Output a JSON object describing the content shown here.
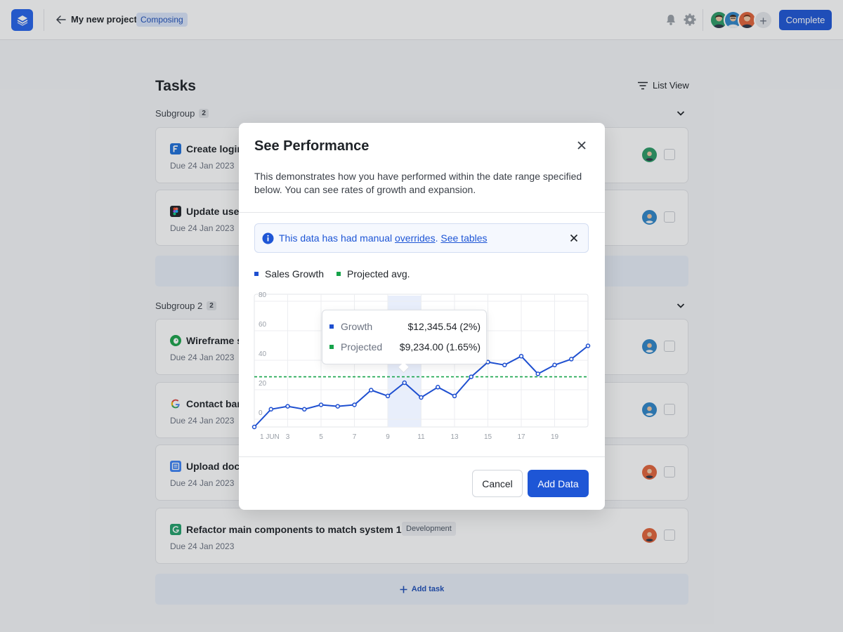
{
  "header": {
    "project_title": "My new project",
    "status_badge": "Composing",
    "complete_label": "Complete",
    "add_member": "+"
  },
  "main": {
    "title": "Tasks",
    "view_label": "List View",
    "subgroups": [
      {
        "label": "Subgroup",
        "count": "2"
      },
      {
        "label": "Subgroup 2",
        "count": "2"
      }
    ],
    "tasks": [
      {
        "title": "Create login",
        "due": "Due 24 Jan 2023",
        "icon": "f-app-icon",
        "icon_color": "#1e6fd9"
      },
      {
        "title": "Update user",
        "due": "Due 24 Jan 2023",
        "icon": "figma-icon",
        "icon_color": "#1f2328"
      },
      {
        "title": "Wireframe s",
        "due": "Due 24 Jan 2023",
        "icon": "evernote-icon",
        "icon_color": "#1aa34a"
      },
      {
        "title": "Contact ban",
        "due": "Due 24 Jan 2023",
        "icon": "google-icon",
        "icon_color": "#ffffff"
      },
      {
        "title": "Upload docu",
        "due": "Due 24 Jan 2023",
        "icon": "docs-icon",
        "icon_color": "#3b82f6"
      },
      {
        "title": "Refactor main components to match system 1.4",
        "due": "Due 24 Jan 2023",
        "tag": "Development",
        "icon": "g-app-icon",
        "icon_color": "#22a06b"
      }
    ],
    "add_task_label": "Add task"
  },
  "modal": {
    "title": "See Performance",
    "description": "This demonstrates how you have performed within the date range specified below. You can see rates of growth and expansion.",
    "alert": {
      "prefix": "This data has had manual ",
      "link1": "overrides",
      "sep": ". ",
      "link2": "See tables"
    },
    "legend": [
      {
        "label": "Sales Growth",
        "color": "#1e4fd0"
      },
      {
        "label": "Projected avg.",
        "color": "#16a34a"
      }
    ],
    "tooltip": {
      "growth_label": "Growth",
      "growth_value": "$12,345.54 (2%)",
      "projected_label": "Projected",
      "projected_value": "$9,234.00 (1.65%)"
    },
    "cancel_label": "Cancel",
    "add_label": "Add Data"
  },
  "colors": {
    "accent": "#1e56d6",
    "growth": "#1e4fd0",
    "projected": "#16a34a"
  },
  "chart_data": {
    "type": "line",
    "title": "",
    "x": [
      1,
      2,
      3,
      4,
      5,
      6,
      7,
      8,
      9,
      10,
      11,
      12,
      13,
      14,
      15,
      16,
      17,
      18,
      19,
      20,
      21
    ],
    "x_tick_labels": [
      "1 JUN",
      "3",
      "5",
      "7",
      "9",
      "11",
      "13",
      "15",
      "17",
      "19"
    ],
    "y_tick_labels": [
      "80",
      "60",
      "40",
      "20",
      "0"
    ],
    "ylim": [
      -10,
      80
    ],
    "series": [
      {
        "name": "Sales Growth",
        "values": [
          -10,
          2,
          4,
          2,
          5,
          4,
          5,
          15,
          11,
          20,
          10,
          17,
          11,
          24,
          34,
          32,
          38,
          26,
          32,
          36,
          45
        ]
      },
      {
        "name": "Projected avg.",
        "values": [
          24,
          24,
          24,
          24,
          24,
          24,
          24,
          24,
          24,
          24,
          24,
          24,
          24,
          24,
          24,
          24,
          24,
          24,
          24,
          24,
          24
        ]
      }
    ],
    "highlight_x": 10,
    "grid": true
  }
}
